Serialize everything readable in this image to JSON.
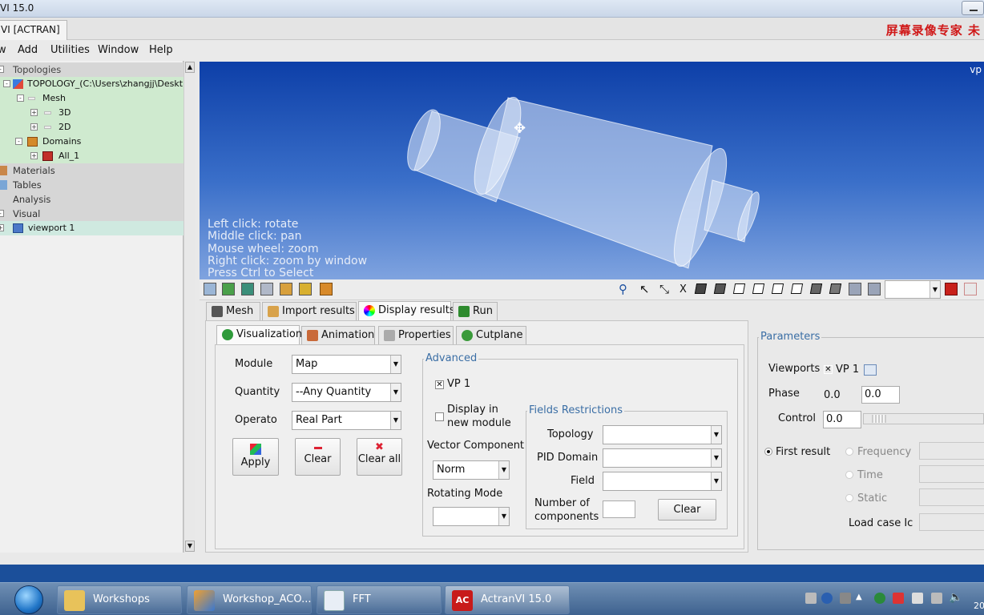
{
  "window": {
    "title": "VI 15.0",
    "tab": "VI [ACTRAN]",
    "watermark": "屏幕录像专家 未"
  },
  "menu": [
    "w",
    "Add",
    "Utilities",
    "Window",
    "Help"
  ],
  "tree": {
    "topologies": "Topologies",
    "topology": "TOPOLOGY_(C:\\Users\\zhangjj\\Deskt...",
    "mesh": "Mesh",
    "d3": "3D",
    "d2": "2D",
    "domains": "Domains",
    "all1": "All_1",
    "materials": "Materials",
    "tables": "Tables",
    "analysis": "Analysis",
    "visual": "Visual",
    "viewport1": "viewport 1"
  },
  "viewport": {
    "corner": "vp",
    "hints": [
      "Left click: rotate",
      "Middle click: pan",
      "Mouse wheel: zoom",
      "Right click: zoom by window",
      "Press Ctrl to Select"
    ],
    "axis_label": "X"
  },
  "tabs": {
    "mesh": "Mesh",
    "import": "Import results",
    "display": "Display results",
    "run": "Run"
  },
  "subtabs": {
    "visualization": "Visualization",
    "animation": "Animation",
    "properties": "Properties",
    "cutplane": "Cutplane"
  },
  "form": {
    "module_label": "Module",
    "module_value": "Map",
    "quantity_label": "Quantity",
    "quantity_value": "--Any Quantity",
    "operato_label": "Operato",
    "operato_value": "Real Part",
    "apply": "Apply",
    "clear": "Clear",
    "clear_all": "Clear all"
  },
  "advanced": {
    "title": "Advanced",
    "vp1": "VP 1",
    "display_in_1": "Display in",
    "display_in_2": "new module",
    "vector_label": "Vector Component",
    "vector_value": "Norm",
    "rotating_label": "Rotating Mode",
    "rotating_value": ""
  },
  "fields": {
    "title": "Fields Restrictions",
    "topology": "Topology",
    "pid": "PID Domain",
    "field": "Field",
    "num1": "Number of",
    "num2": "components",
    "clear": "Clear"
  },
  "parameters": {
    "title": "Parameters",
    "viewports": "Viewports",
    "vp1": "VP 1",
    "phase": "Phase",
    "phase_a": "0.0",
    "phase_b": "0.0",
    "control": "Control",
    "control_value": "0.0",
    "first_result": "First result",
    "frequency": "Frequency",
    "time": "Time",
    "static": "Static",
    "load_case": "Load case Ic"
  },
  "taskbar": {
    "items": [
      "Workshops",
      "Workshop_ACO...",
      "FFT",
      "ActranVI 15.0"
    ],
    "clock": "20"
  },
  "colors": {
    "viewport_top": "#0d3fa8",
    "viewport_bottom": "#7fa3df",
    "tree_green": "#cfeacf",
    "status": "#1b4f9a"
  }
}
